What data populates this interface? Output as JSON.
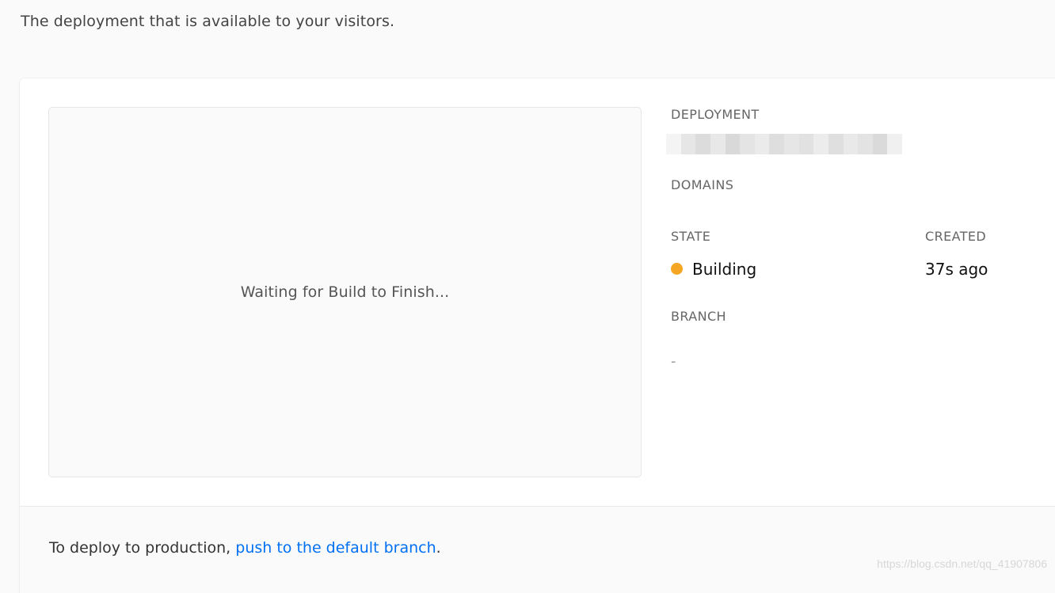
{
  "header": {
    "subtitle": "The deployment that is available to your visitors."
  },
  "preview": {
    "message": "Waiting for Build to Finish..."
  },
  "details": {
    "deployment_label": "DEPLOYMENT",
    "domains_label": "DOMAINS",
    "state_label": "STATE",
    "state_value": "Building",
    "state_color": "#f5a623",
    "created_label": "CREATED",
    "created_value": "37s ago",
    "branch_label": "BRANCH",
    "branch_value": "-"
  },
  "footer": {
    "text_prefix": "To deploy to production, ",
    "link_text": "push to the default branch",
    "text_suffix": "."
  },
  "watermark": "https://blog.csdn.net/qq_41907806",
  "colors": {
    "accent_link": "#0070f3",
    "building": "#f5a623"
  }
}
